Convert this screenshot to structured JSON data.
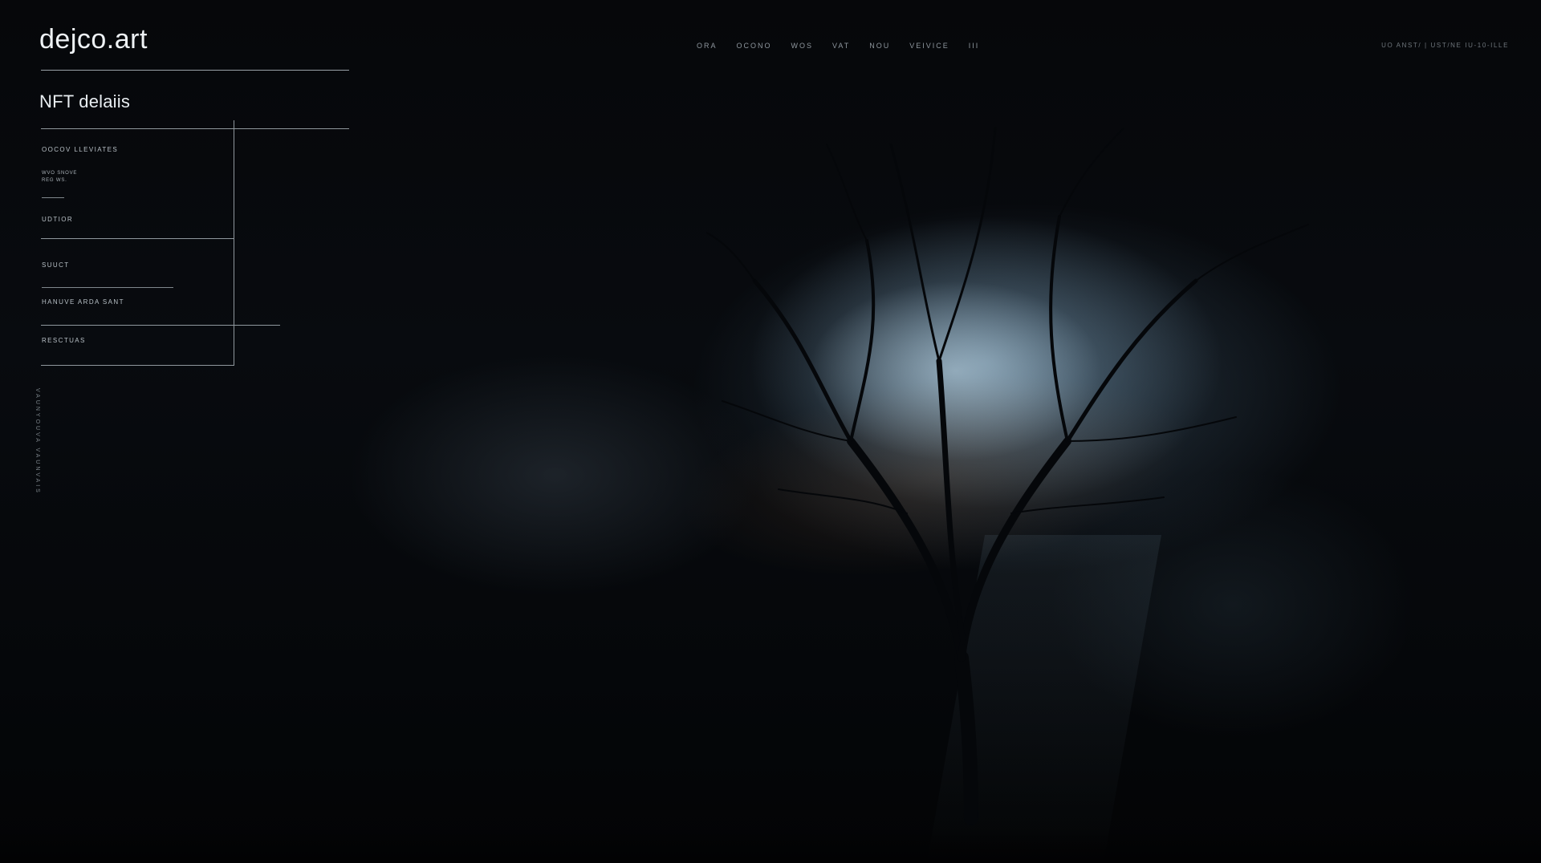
{
  "brand": {
    "logo_text": "dejco.art"
  },
  "nav": {
    "items": [
      "ORA",
      "OCONO",
      "WOS",
      "VAT",
      "NOU",
      "VEIVICE",
      "III"
    ]
  },
  "top_right": {
    "text": "UO ANST/ | UST/NE IU-10-ILLE"
  },
  "panel": {
    "title": "NFT delaiis",
    "fields": {
      "label_1": "OOCOV LLEVIATES",
      "small_line_1": "WVO SNOVE",
      "small_line_2": "REG WS.",
      "label_2": "UDTIOR",
      "label_3": "SUUCT",
      "label_4": "HANUVE ARDA SANT",
      "label_5": "RESCTUAS"
    }
  },
  "side": {
    "vertical_text": "VAUNYOUVA  VAUNVAIS"
  },
  "colors": {
    "background": "#050608",
    "accent_light": "#c8e1f0",
    "accent_amber": "#aa7850",
    "rule": "#8f979d"
  }
}
